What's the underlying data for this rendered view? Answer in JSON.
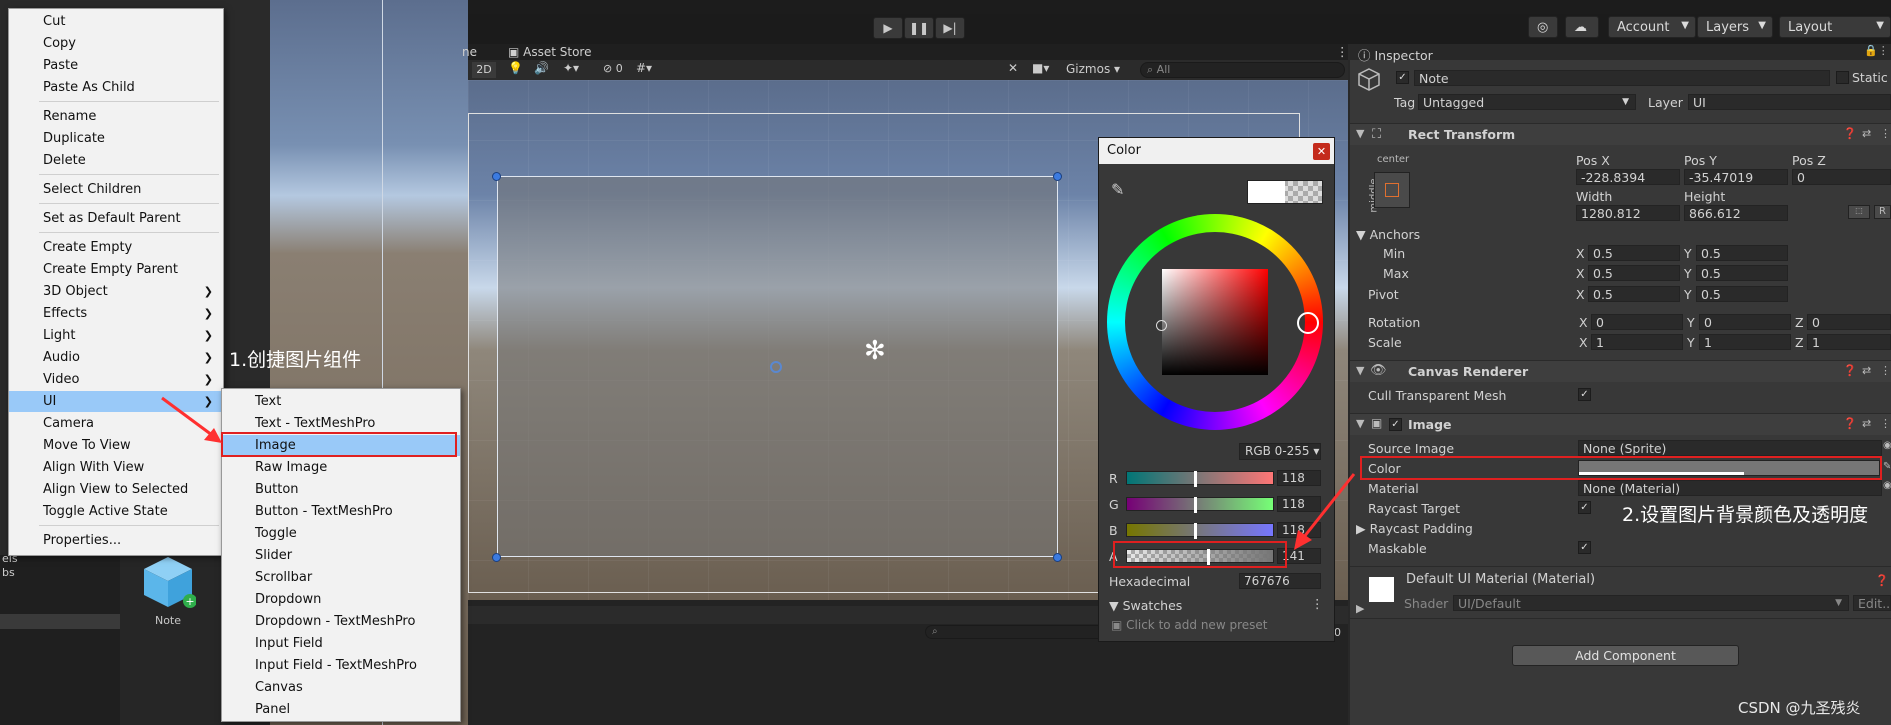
{
  "toolbar": {
    "play_icon": "play-icon",
    "pause_icon": "pause-icon",
    "step_icon": "step-icon",
    "account": "Account",
    "layers": "Layers",
    "layout": "Layout"
  },
  "scene": {
    "tab_partial": "ne",
    "asset_store": "Asset Store",
    "mode_2d": "2D",
    "audio_count": "0",
    "gizmos": "Gizmos",
    "search_placeholder": "All"
  },
  "context_menu": {
    "items": [
      "Cut",
      "Copy",
      "Paste",
      "Paste As Child",
      "Rename",
      "Duplicate",
      "Delete",
      "Select Children",
      "Set as Default Parent",
      "Create Empty",
      "Create Empty Parent",
      "3D Object",
      "Effects",
      "Light",
      "Audio",
      "Video",
      "UI",
      "Camera",
      "Move To View",
      "Align With View",
      "Align View to Selected",
      "Toggle Active State",
      "Properties..."
    ]
  },
  "ui_submenu": {
    "items": [
      "Text",
      "Text - TextMeshPro",
      "Image",
      "Raw Image",
      "Button",
      "Button - TextMeshPro",
      "Toggle",
      "Slider",
      "Scrollbar",
      "Dropdown",
      "Dropdown - TextMeshPro",
      "Input Field",
      "Input Field - TextMeshPro",
      "Canvas",
      "Panel"
    ]
  },
  "project": {
    "prefab_label": "Note",
    "left_partial": [
      "els",
      "bs"
    ]
  },
  "color_picker": {
    "title": "Color",
    "mode": "RGB 0-255",
    "channels": [
      {
        "label": "R",
        "value": "118",
        "level": 0.46
      },
      {
        "label": "G",
        "value": "118",
        "level": 0.46
      },
      {
        "label": "B",
        "value": "118",
        "level": 0.46
      },
      {
        "label": "A",
        "value": "141",
        "level": 0.55
      }
    ],
    "hex_label": "Hexadecimal",
    "hex_value": "767676",
    "swatches_label": "Swatches",
    "swatches_hint": "Click to add new preset",
    "accent": "#767676"
  },
  "inspector": {
    "tab": "Inspector",
    "object_name": "Note",
    "static": "Static",
    "tag_label": "Tag",
    "tag_value": "Untagged",
    "layer_label": "Layer",
    "layer_value": "UI",
    "rect_transform": {
      "title": "Rect Transform",
      "anchor_h": "center",
      "anchor_v": "middle",
      "pos_x_label": "Pos X",
      "pos_y_label": "Pos Y",
      "pos_z_label": "Pos Z",
      "pos_x": "-228.8394",
      "pos_y": "-35.47019",
      "pos_z": "0",
      "width_label": "Width",
      "height_label": "Height",
      "width": "1280.812",
      "height": "866.612",
      "r_button": "R",
      "anchors": "Anchors",
      "min": "Min",
      "max": "Max",
      "pivot": "Pivot",
      "min_x": "0.5",
      "min_y": "0.5",
      "max_x": "0.5",
      "max_y": "0.5",
      "pivot_x": "0.5",
      "pivot_y": "0.5",
      "rotation": "Rotation",
      "rot_x": "0",
      "rot_y": "0",
      "rot_z": "0",
      "scale": "Scale",
      "scale_x": "1",
      "scale_y": "1",
      "scale_z": "1",
      "x": "X",
      "y": "Y",
      "z": "Z"
    },
    "canvas_renderer": {
      "title": "Canvas Renderer",
      "cull": "Cull Transparent Mesh"
    },
    "image": {
      "title": "Image",
      "source_label": "Source Image",
      "source_value": "None (Sprite)",
      "color_label": "Color",
      "material_label": "Material",
      "material_value": "None (Material)",
      "raycast_target": "Raycast Target",
      "raycast_padding": "Raycast Padding",
      "maskable": "Maskable"
    },
    "material": {
      "name": "Default UI Material (Material)",
      "shader_label": "Shader",
      "shader_value": "UI/Default",
      "edit": "Edit..."
    },
    "add_component": "Add Component"
  },
  "annotations": {
    "step1": "1.创捷图片组件",
    "step2": "2.设置图片背景颜色及透明度",
    "watermark": "CSDN @九圣残炎"
  }
}
